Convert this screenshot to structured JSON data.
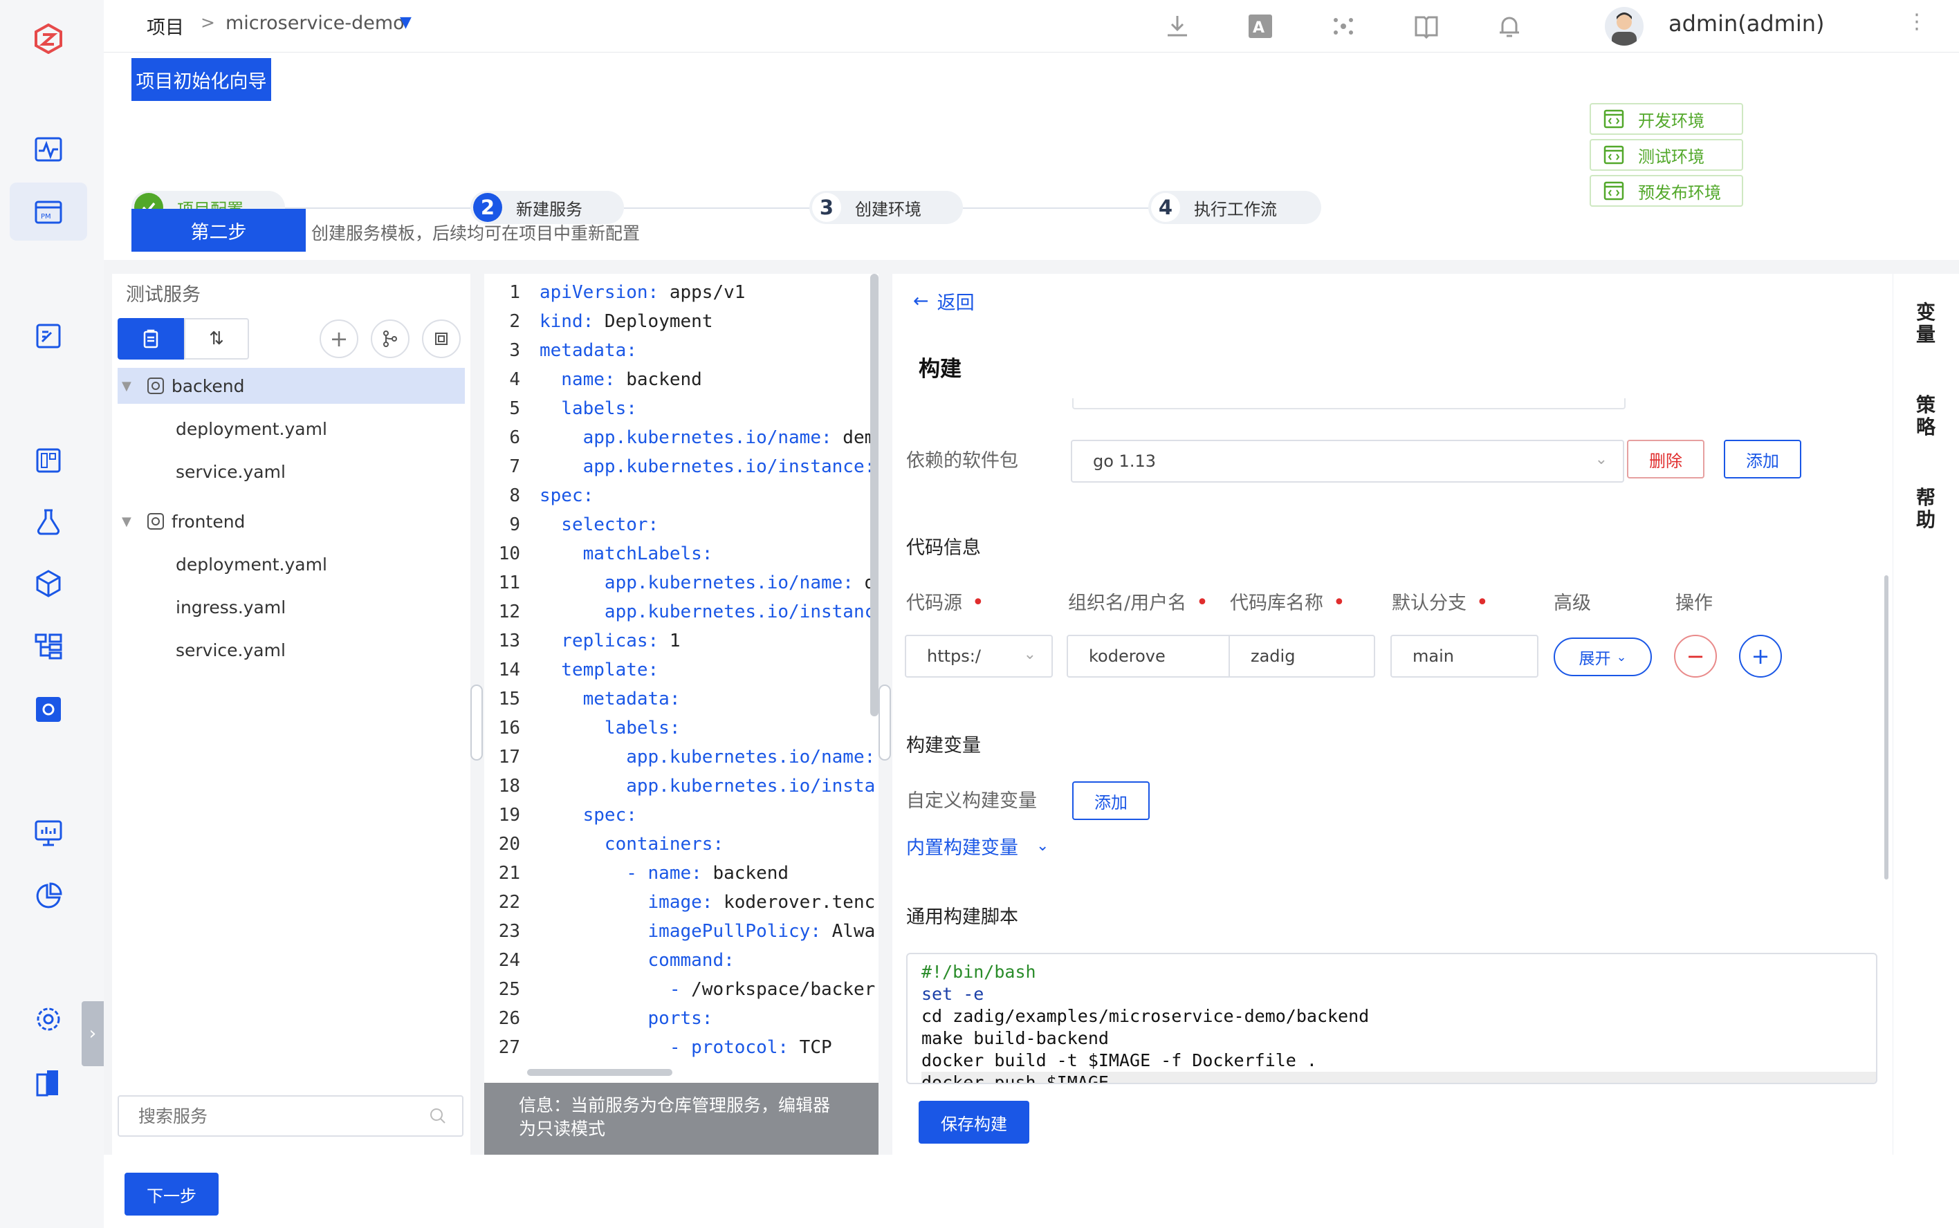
{
  "topbar": {
    "breadcrumb_root": "项目",
    "breadcrumb_sep": ">",
    "breadcrumb_project": "microservice-demo",
    "username": "admin(admin)"
  },
  "wizard": {
    "title": "项目初始化向导",
    "steps": [
      {
        "num": "",
        "label": "项目配置",
        "status": "done"
      },
      {
        "num": "2",
        "label": "新建服务",
        "status": "active"
      },
      {
        "num": "3",
        "label": "创建环境",
        "status": "todo"
      },
      {
        "num": "4",
        "label": "执行工作流",
        "status": "todo"
      }
    ],
    "current_step_label": "第二步",
    "current_step_desc": "创建服务模板，后续均可在项目中重新配置",
    "envs": [
      "开发环境",
      "测试环境",
      "预发布环境"
    ]
  },
  "services": {
    "title": "测试服务",
    "tree": [
      {
        "name": "backend",
        "type": "service",
        "selected": true
      },
      {
        "name": "deployment.yaml",
        "type": "file"
      },
      {
        "name": "service.yaml",
        "type": "file"
      },
      {
        "name": "frontend",
        "type": "service",
        "selected": false
      },
      {
        "name": "deployment.yaml",
        "type": "file"
      },
      {
        "name": "ingress.yaml",
        "type": "file"
      },
      {
        "name": "service.yaml",
        "type": "file"
      }
    ],
    "search_placeholder": "搜索服务"
  },
  "editor": {
    "lines": [
      {
        "n": "1",
        "key": "apiVersion:",
        "val": " apps/v1"
      },
      {
        "n": "2",
        "key": "kind:",
        "val": " Deployment"
      },
      {
        "n": "3",
        "key": "metadata:",
        "val": ""
      },
      {
        "n": "4",
        "key": "  name:",
        "val": " backend"
      },
      {
        "n": "5",
        "key": "  labels:",
        "val": ""
      },
      {
        "n": "6",
        "key": "    app.kubernetes.io/name:",
        "val": " dem"
      },
      {
        "n": "7",
        "key": "    app.kubernetes.io/instance:",
        "val": ""
      },
      {
        "n": "8",
        "key": "spec:",
        "val": ""
      },
      {
        "n": "9",
        "key": "  selector:",
        "val": ""
      },
      {
        "n": "10",
        "key": "    matchLabels:",
        "val": ""
      },
      {
        "n": "11",
        "key": "      app.kubernetes.io/name:",
        "val": " d"
      },
      {
        "n": "12",
        "key": "      app.kubernetes.io/instanc",
        "val": ""
      },
      {
        "n": "13",
        "key": "  replicas:",
        "val": " 1"
      },
      {
        "n": "14",
        "key": "  template:",
        "val": ""
      },
      {
        "n": "15",
        "key": "    metadata:",
        "val": ""
      },
      {
        "n": "16",
        "key": "      labels:",
        "val": ""
      },
      {
        "n": "17",
        "key": "        app.kubernetes.io/name:",
        "val": ""
      },
      {
        "n": "18",
        "key": "        app.kubernetes.io/insta",
        "val": ""
      },
      {
        "n": "19",
        "key": "    spec:",
        "val": ""
      },
      {
        "n": "20",
        "key": "      containers:",
        "val": ""
      },
      {
        "n": "21",
        "key": "        - name:",
        "val": " backend"
      },
      {
        "n": "22",
        "key": "          image:",
        "val": " koderover.tenc"
      },
      {
        "n": "23",
        "key": "          imagePullPolicy:",
        "val": " Alwa"
      },
      {
        "n": "24",
        "key": "          command:",
        "val": ""
      },
      {
        "n": "25",
        "key": "            - ",
        "val": "/workspace/backer"
      },
      {
        "n": "26",
        "key": "          ports:",
        "val": ""
      },
      {
        "n": "27",
        "key": "            - protocol:",
        "val": " TCP"
      }
    ],
    "readonly_notice": "信息：当前服务为仓库管理服务，编辑器为只读模式"
  },
  "build": {
    "back": "返回",
    "title": "构建",
    "deps_label": "依赖的软件包",
    "deps_value": "go 1.13",
    "delete": "删除",
    "add": "添加",
    "code_info": "代码信息",
    "cols": [
      "代码源",
      "组织名/用户名",
      "代码库名称",
      "默认分支",
      "高级",
      "操作"
    ],
    "repo_source": "https:/",
    "repo_owner": "koderove",
    "repo_name": "zadig",
    "repo_branch": "main",
    "expand": "展开",
    "build_vars": "构建变量",
    "custom_vars": "自定义构建变量",
    "builtin_vars": "内置构建变量",
    "script_title": "通用构建脚本",
    "script": [
      "#!/bin/bash",
      "set -e",
      "cd zadig/examples/microservice-demo/backend",
      "make build-backend",
      "docker build -t $IMAGE -f Dockerfile .",
      "docker push $IMAGE"
    ],
    "save": "保存构建"
  },
  "rightbar": [
    "变量",
    "策略",
    "帮助"
  ],
  "footer": {
    "next": "下一步"
  },
  "colors": {
    "primary": "#1a57e6",
    "success": "#52a82a",
    "danger": "#e02d2d"
  }
}
